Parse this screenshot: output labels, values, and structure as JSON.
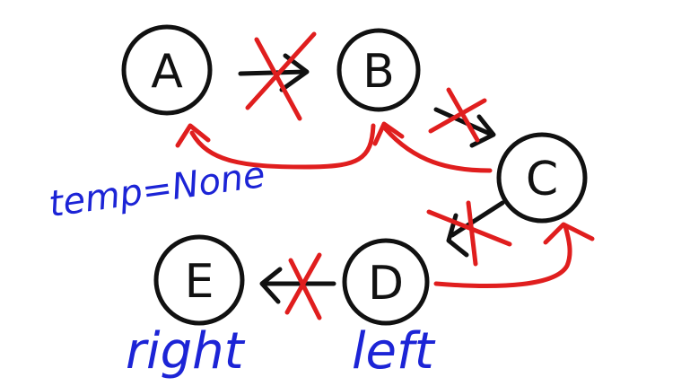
{
  "colors": {
    "ink": "#111111",
    "correction": "#e01e1e",
    "annotation": "#1c24d6",
    "background": "#ffffff"
  },
  "nodes": [
    {
      "id": "A",
      "label": "A"
    },
    {
      "id": "B",
      "label": "B"
    },
    {
      "id": "C",
      "label": "C"
    },
    {
      "id": "D",
      "label": "D"
    },
    {
      "id": "E",
      "label": "E"
    }
  ],
  "original_links": [
    {
      "from": "A",
      "to": "B",
      "crossed_out": true
    },
    {
      "from": "B",
      "to": "C",
      "crossed_out": true
    },
    {
      "from": "C",
      "to": "D",
      "crossed_out": true
    },
    {
      "from": "D",
      "to": "E",
      "crossed_out": true
    }
  ],
  "reversed_links": [
    {
      "from": "B",
      "to": "A"
    },
    {
      "from": "C",
      "to": "B"
    },
    {
      "from": "D",
      "to": "C"
    }
  ],
  "annotations": {
    "temp": "temp=None",
    "right": "right",
    "left": "left"
  }
}
